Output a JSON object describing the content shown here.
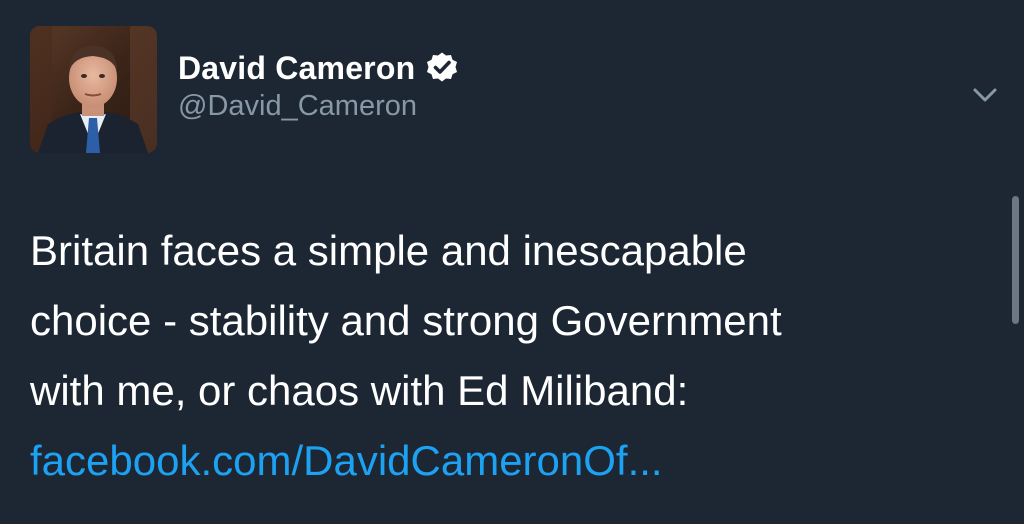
{
  "author": {
    "display_name": "David Cameron",
    "handle": "@David_Cameron",
    "verified": true
  },
  "tweet": {
    "lines": [
      "Britain faces a simple and inescapable",
      "choice - stability and strong Government",
      "with me, or chaos with Ed Miliband:"
    ],
    "link_text": "facebook.com/DavidCameronOf..."
  },
  "icons": {
    "verified": "verified-badge-icon",
    "menu": "chevron-down-icon"
  },
  "colors": {
    "background": "#1c2733",
    "link": "#1da1f2",
    "handle": "#8899a6",
    "text": "#ffffff"
  }
}
